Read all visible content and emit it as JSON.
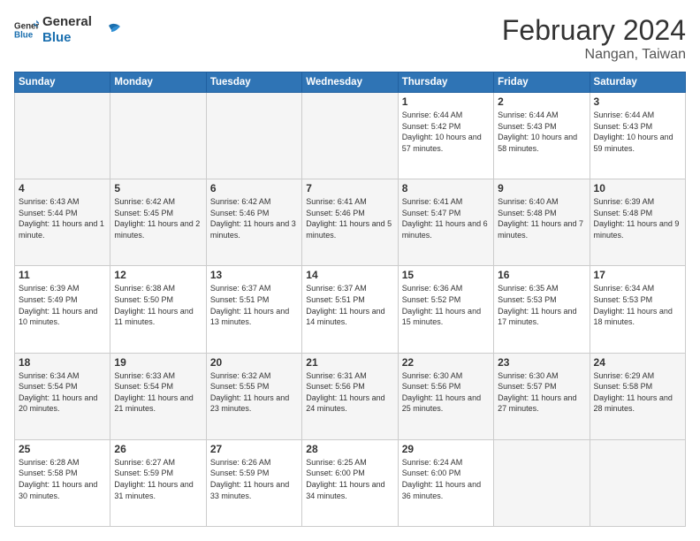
{
  "header": {
    "logo_line1": "General",
    "logo_line2": "Blue",
    "main_title": "February 2024",
    "subtitle": "Nangan, Taiwan"
  },
  "days_of_week": [
    "Sunday",
    "Monday",
    "Tuesday",
    "Wednesday",
    "Thursday",
    "Friday",
    "Saturday"
  ],
  "weeks": [
    [
      {
        "day": "",
        "info": ""
      },
      {
        "day": "",
        "info": ""
      },
      {
        "day": "",
        "info": ""
      },
      {
        "day": "",
        "info": ""
      },
      {
        "day": "1",
        "info": "Sunrise: 6:44 AM\nSunset: 5:42 PM\nDaylight: 10 hours and 57 minutes."
      },
      {
        "day": "2",
        "info": "Sunrise: 6:44 AM\nSunset: 5:43 PM\nDaylight: 10 hours and 58 minutes."
      },
      {
        "day": "3",
        "info": "Sunrise: 6:44 AM\nSunset: 5:43 PM\nDaylight: 10 hours and 59 minutes."
      }
    ],
    [
      {
        "day": "4",
        "info": "Sunrise: 6:43 AM\nSunset: 5:44 PM\nDaylight: 11 hours and 1 minute."
      },
      {
        "day": "5",
        "info": "Sunrise: 6:42 AM\nSunset: 5:45 PM\nDaylight: 11 hours and 2 minutes."
      },
      {
        "day": "6",
        "info": "Sunrise: 6:42 AM\nSunset: 5:46 PM\nDaylight: 11 hours and 3 minutes."
      },
      {
        "day": "7",
        "info": "Sunrise: 6:41 AM\nSunset: 5:46 PM\nDaylight: 11 hours and 5 minutes."
      },
      {
        "day": "8",
        "info": "Sunrise: 6:41 AM\nSunset: 5:47 PM\nDaylight: 11 hours and 6 minutes."
      },
      {
        "day": "9",
        "info": "Sunrise: 6:40 AM\nSunset: 5:48 PM\nDaylight: 11 hours and 7 minutes."
      },
      {
        "day": "10",
        "info": "Sunrise: 6:39 AM\nSunset: 5:48 PM\nDaylight: 11 hours and 9 minutes."
      }
    ],
    [
      {
        "day": "11",
        "info": "Sunrise: 6:39 AM\nSunset: 5:49 PM\nDaylight: 11 hours and 10 minutes."
      },
      {
        "day": "12",
        "info": "Sunrise: 6:38 AM\nSunset: 5:50 PM\nDaylight: 11 hours and 11 minutes."
      },
      {
        "day": "13",
        "info": "Sunrise: 6:37 AM\nSunset: 5:51 PM\nDaylight: 11 hours and 13 minutes."
      },
      {
        "day": "14",
        "info": "Sunrise: 6:37 AM\nSunset: 5:51 PM\nDaylight: 11 hours and 14 minutes."
      },
      {
        "day": "15",
        "info": "Sunrise: 6:36 AM\nSunset: 5:52 PM\nDaylight: 11 hours and 15 minutes."
      },
      {
        "day": "16",
        "info": "Sunrise: 6:35 AM\nSunset: 5:53 PM\nDaylight: 11 hours and 17 minutes."
      },
      {
        "day": "17",
        "info": "Sunrise: 6:34 AM\nSunset: 5:53 PM\nDaylight: 11 hours and 18 minutes."
      }
    ],
    [
      {
        "day": "18",
        "info": "Sunrise: 6:34 AM\nSunset: 5:54 PM\nDaylight: 11 hours and 20 minutes."
      },
      {
        "day": "19",
        "info": "Sunrise: 6:33 AM\nSunset: 5:54 PM\nDaylight: 11 hours and 21 minutes."
      },
      {
        "day": "20",
        "info": "Sunrise: 6:32 AM\nSunset: 5:55 PM\nDaylight: 11 hours and 23 minutes."
      },
      {
        "day": "21",
        "info": "Sunrise: 6:31 AM\nSunset: 5:56 PM\nDaylight: 11 hours and 24 minutes."
      },
      {
        "day": "22",
        "info": "Sunrise: 6:30 AM\nSunset: 5:56 PM\nDaylight: 11 hours and 25 minutes."
      },
      {
        "day": "23",
        "info": "Sunrise: 6:30 AM\nSunset: 5:57 PM\nDaylight: 11 hours and 27 minutes."
      },
      {
        "day": "24",
        "info": "Sunrise: 6:29 AM\nSunset: 5:58 PM\nDaylight: 11 hours and 28 minutes."
      }
    ],
    [
      {
        "day": "25",
        "info": "Sunrise: 6:28 AM\nSunset: 5:58 PM\nDaylight: 11 hours and 30 minutes."
      },
      {
        "day": "26",
        "info": "Sunrise: 6:27 AM\nSunset: 5:59 PM\nDaylight: 11 hours and 31 minutes."
      },
      {
        "day": "27",
        "info": "Sunrise: 6:26 AM\nSunset: 5:59 PM\nDaylight: 11 hours and 33 minutes."
      },
      {
        "day": "28",
        "info": "Sunrise: 6:25 AM\nSunset: 6:00 PM\nDaylight: 11 hours and 34 minutes."
      },
      {
        "day": "29",
        "info": "Sunrise: 6:24 AM\nSunset: 6:00 PM\nDaylight: 11 hours and 36 minutes."
      },
      {
        "day": "",
        "info": ""
      },
      {
        "day": "",
        "info": ""
      }
    ]
  ]
}
